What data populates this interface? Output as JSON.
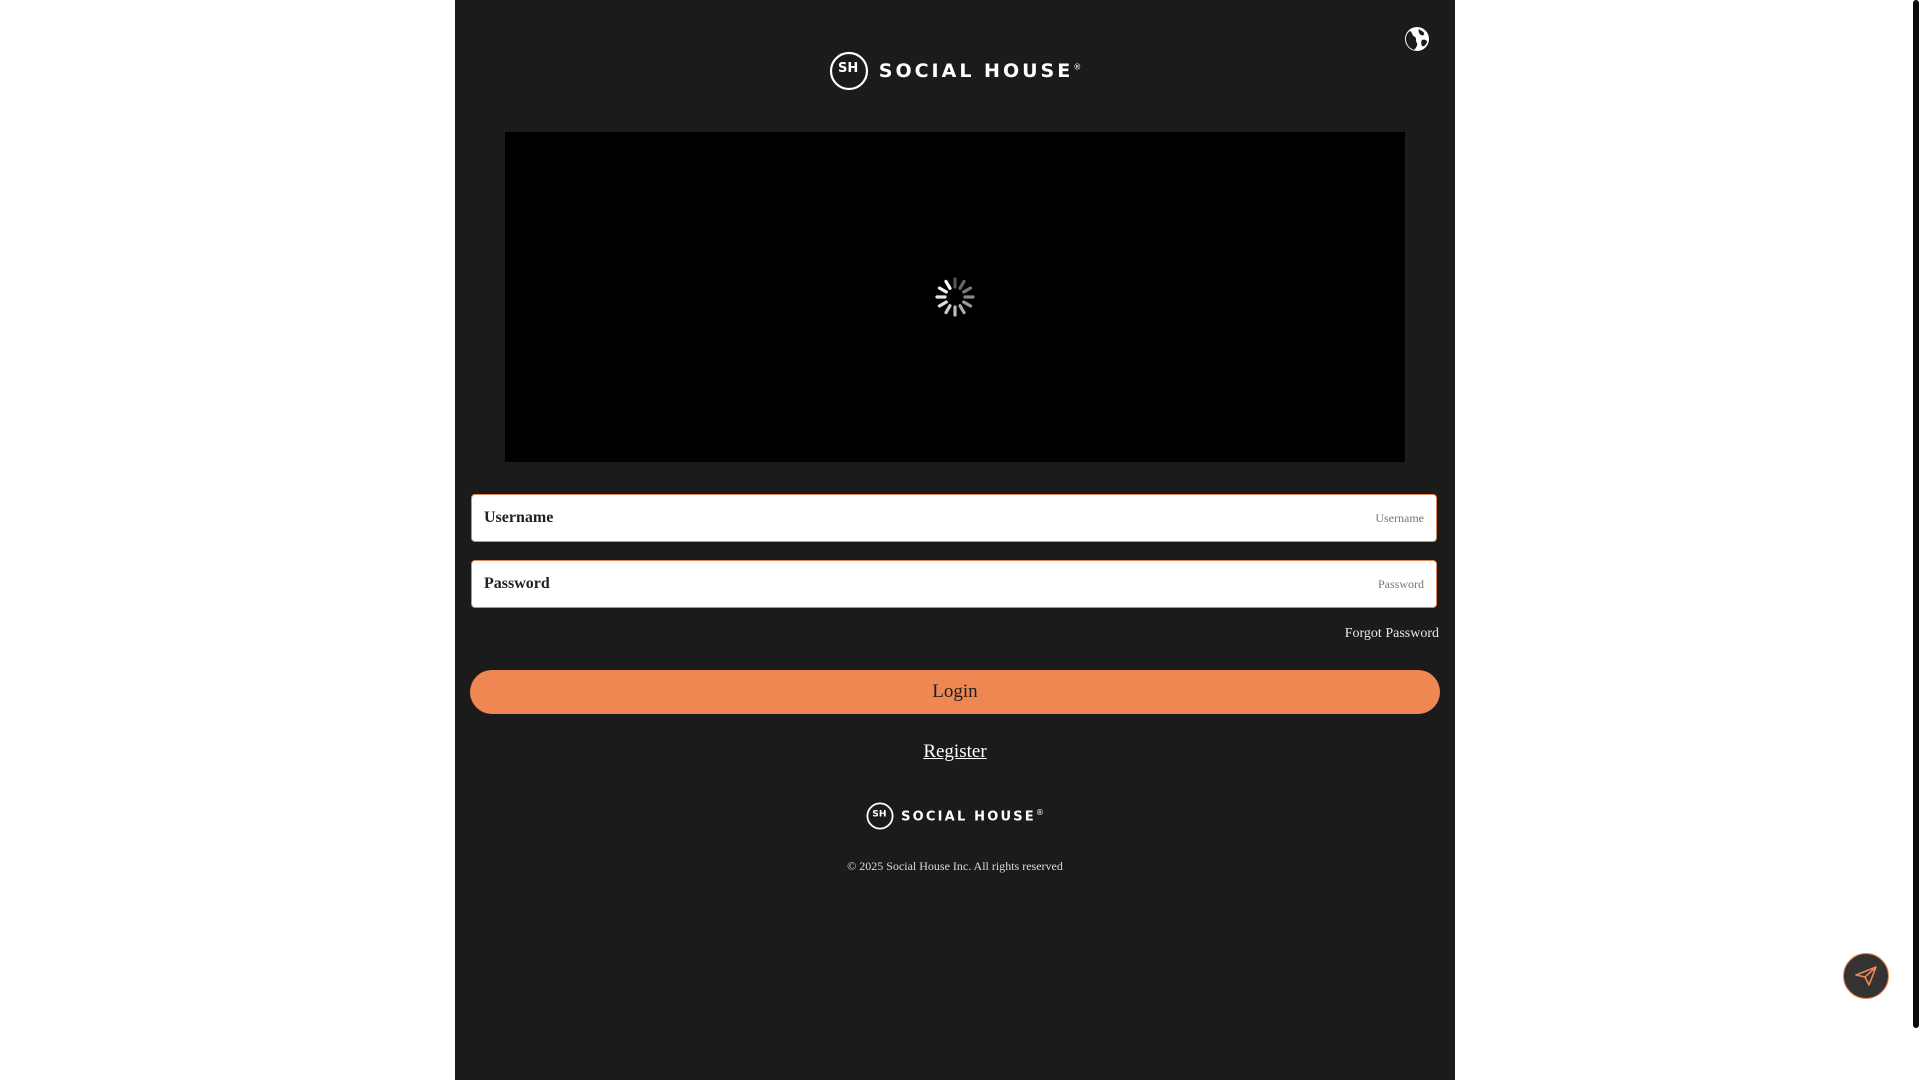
{
  "header": {
    "language_icon": "globe-icon",
    "brand_monogram": "SH",
    "brand_name": "SOCIAL HOUSE",
    "brand_mark": "®"
  },
  "video": {
    "state_icon": "loading-spinner-icon"
  },
  "form": {
    "username_label": "Username",
    "username_placeholder": "Username",
    "username_value": "",
    "password_label": "Password",
    "password_placeholder": "Password",
    "password_value": "",
    "forgot_password": "Forgot Password",
    "login_button": "Login",
    "register_link": "Register"
  },
  "footer": {
    "brand_monogram": "SH",
    "brand_name": "SOCIAL HOUSE",
    "brand_mark": "®",
    "copyright": "© 2025 Social House Inc. All rights reserved"
  },
  "fab": {
    "icon": "paper-plane-icon"
  },
  "colors": {
    "panel_background": "#1b1b1b",
    "accent": "#ef8752",
    "video_background": "#000000"
  }
}
